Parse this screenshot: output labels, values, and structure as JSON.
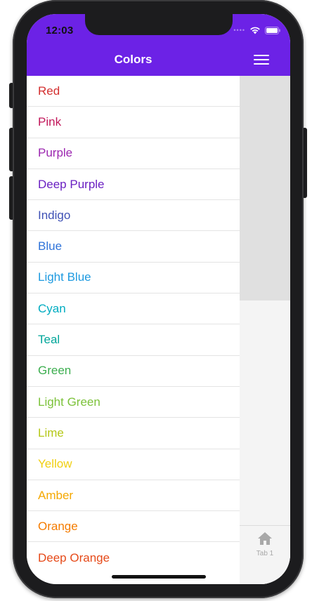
{
  "status_bar": {
    "time": "12:03"
  },
  "header": {
    "title": "Colors"
  },
  "colors": [
    {
      "label": "Red",
      "color": "#d32f2f"
    },
    {
      "label": "Pink",
      "color": "#c2185b"
    },
    {
      "label": "Purple",
      "color": "#9c27b0"
    },
    {
      "label": "Deep Purple",
      "color": "#6a1fc2"
    },
    {
      "label": "Indigo",
      "color": "#3f51b5"
    },
    {
      "label": "Blue",
      "color": "#2f73d9"
    },
    {
      "label": "Light Blue",
      "color": "#1e9ae0"
    },
    {
      "label": "Cyan",
      "color": "#00acc1"
    },
    {
      "label": "Teal",
      "color": "#00a69a"
    },
    {
      "label": "Green",
      "color": "#3cae4f"
    },
    {
      "label": "Light Green",
      "color": "#7cc23a"
    },
    {
      "label": "Lime",
      "color": "#b5c818"
    },
    {
      "label": "Yellow",
      "color": "#f0cf10"
    },
    {
      "label": "Amber",
      "color": "#f5a800"
    },
    {
      "label": "Orange",
      "color": "#f57c00"
    },
    {
      "label": "Deep Orange",
      "color": "#e64a19"
    }
  ],
  "tabs": [
    {
      "label": "Tab 1",
      "icon": "home-icon"
    }
  ],
  "accent_color": "#6c22e6"
}
